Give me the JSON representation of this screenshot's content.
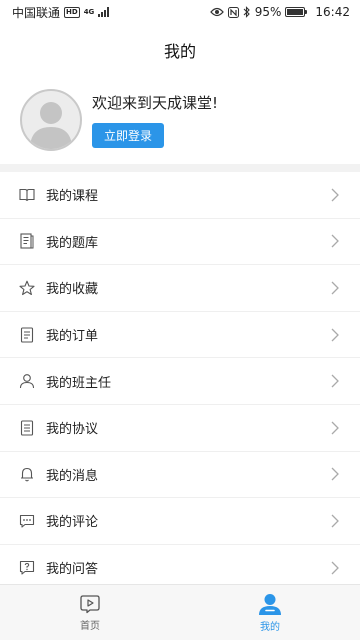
{
  "status_bar": {
    "carrier": "中国联通",
    "hd_badge": "HD",
    "network": "4G",
    "battery": "95%",
    "time": "16:42"
  },
  "header": {
    "title": "我的"
  },
  "profile": {
    "welcome": "欢迎来到天成课堂!",
    "login_label": "立即登录"
  },
  "menu": {
    "items": [
      {
        "label": "我的课程",
        "icon": "book-icon"
      },
      {
        "label": "我的题库",
        "icon": "question-bank-icon"
      },
      {
        "label": "我的收藏",
        "icon": "star-icon"
      },
      {
        "label": "我的订单",
        "icon": "order-icon"
      },
      {
        "label": "我的班主任",
        "icon": "person-icon"
      },
      {
        "label": "我的协议",
        "icon": "agreement-icon"
      },
      {
        "label": "我的消息",
        "icon": "bell-icon"
      },
      {
        "label": "我的评论",
        "icon": "comment-icon"
      },
      {
        "label": "我的问答",
        "icon": "qa-icon"
      }
    ]
  },
  "tabbar": {
    "home_label": "首页",
    "mine_label": "我的"
  },
  "colors": {
    "accent": "#2b95e8"
  }
}
